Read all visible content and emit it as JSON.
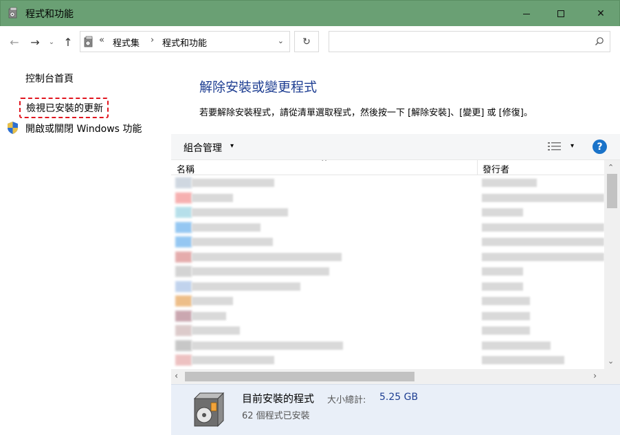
{
  "window": {
    "title": "程式和功能",
    "minimize_label": "",
    "close_glyph": "✕"
  },
  "nav": {
    "back_glyph": "←",
    "forward_glyph": "→",
    "recent_glyph": "⌄",
    "up_glyph": "↑",
    "address_prefix": "«",
    "breadcrumb": [
      "程式集",
      "程式和功能"
    ],
    "breadcrumb_sep": "›",
    "address_dropdown_glyph": "⌄",
    "refresh_glyph": "↻",
    "search_placeholder": ""
  },
  "sidebar": {
    "home": "控制台首頁",
    "view_updates": "檢視已安裝的更新",
    "windows_features": "開啟或關閉 Windows 功能"
  },
  "main": {
    "heading": "解除安裝或變更程式",
    "instructions": "若要解除安裝程式，請從清單選取程式，然後按一下 [解除安裝]、[變更] 或 [修復]。"
  },
  "toolbar": {
    "organize": "組合管理",
    "dropdown_glyph": "▾",
    "help": "?"
  },
  "columns": {
    "name": "名稱",
    "publisher": "發行者",
    "sort_caret": "^"
  },
  "program_rows": [
    {
      "icon_color": "#a8b7c8",
      "name_w": 120,
      "pub_w": 80
    },
    {
      "icon_color": "#f07070",
      "name_w": 60,
      "pub_w": 178
    },
    {
      "icon_color": "#7cc6d9",
      "name_w": 140,
      "pub_w": 60
    },
    {
      "icon_color": "#3f9ae8",
      "name_w": 100,
      "pub_w": 178
    },
    {
      "icon_color": "#3f9ae8",
      "name_w": 118,
      "pub_w": 178
    },
    {
      "icon_color": "#d06a6a",
      "name_w": 218,
      "pub_w": 178
    },
    {
      "icon_color": "#b0b0b0",
      "name_w": 200,
      "pub_w": 60
    },
    {
      "icon_color": "#8fb0e0",
      "name_w": 158,
      "pub_w": 60
    },
    {
      "icon_color": "#e08a2a",
      "name_w": 60,
      "pub_w": 70
    },
    {
      "icon_color": "#a06070",
      "name_w": 50,
      "pub_w": 70
    },
    {
      "icon_color": "#c0a0a0",
      "name_w": 70,
      "pub_w": 70
    },
    {
      "icon_color": "#9a9a9a",
      "name_w": 220,
      "pub_w": 100
    },
    {
      "icon_color": "#e09090",
      "name_w": 120,
      "pub_w": 120
    }
  ],
  "scroll": {
    "up": "⌃",
    "down": "⌄",
    "left": "‹",
    "right": "›"
  },
  "details": {
    "title": "目前安裝的程式",
    "size_label": "大小總計:",
    "size_value": "5.25 GB",
    "count": "62 個程式已安裝"
  },
  "colors": {
    "titlebar": "#6aa074",
    "heading": "#1e3e92",
    "highlight_border": "#e0141e",
    "details_bg": "#e9eff8",
    "help_blue": "#1a73c9"
  }
}
